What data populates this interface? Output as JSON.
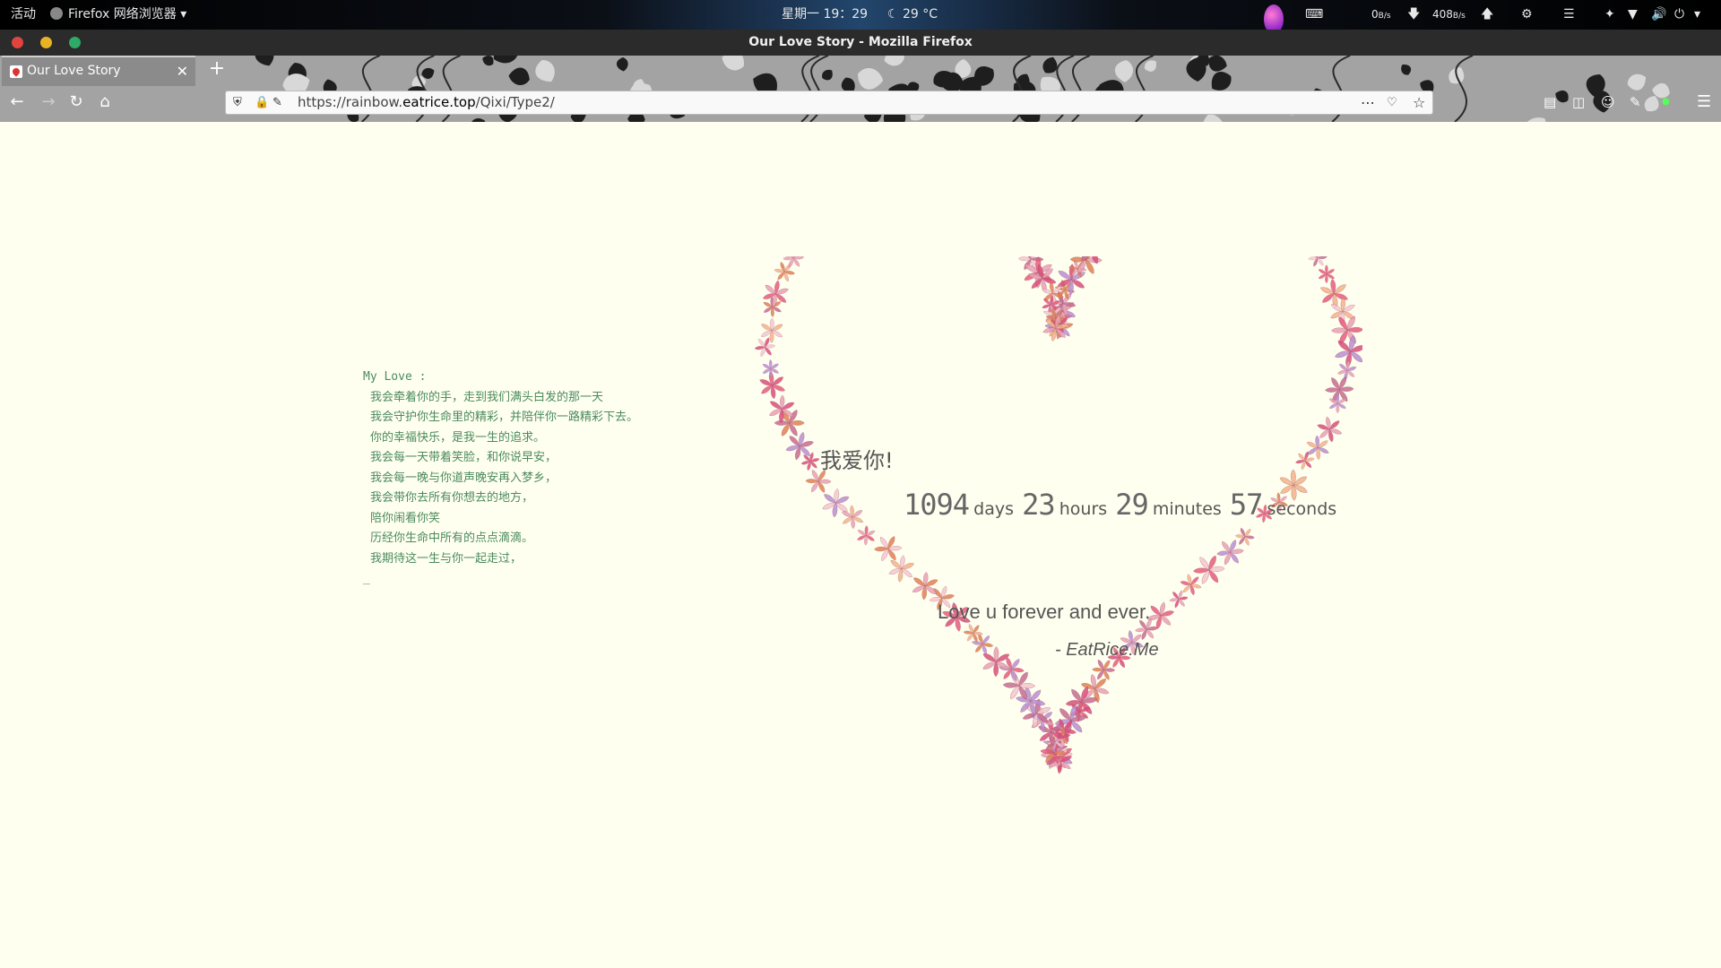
{
  "system_bar": {
    "activities": "活动",
    "app_menu": "Firefox 网络浏览器",
    "clock": "星期一 19：29",
    "weather": "29 °C",
    "net_down": "0",
    "net_down_unit": "B/s",
    "net_up": "408",
    "net_up_unit": "B/s"
  },
  "window": {
    "title": "Our Love Story - Mozilla Firefox"
  },
  "tab": {
    "title": "Our Love Story"
  },
  "urlbar": {
    "url_prefix": "https://rainbow.",
    "url_domain": "eatrice.top",
    "url_path": "/Qixi/Type2/"
  },
  "letter": {
    "greeting": "My Love :",
    "lines": [
      "我会牵着你的手，走到我们满头白发的那一天",
      "我会守护你生命里的精彩，并陪伴你一路精彩下去。",
      "你的幸福快乐，是我一生的追求。",
      "我会每一天带着笑脸，和你说早安，",
      "我会每一晚与你道声晚安再入梦乡，",
      "我会带你去所有你想去的地方，",
      "陪你闹看你笑",
      "历经你生命中所有的点点滴滴。",
      "我期待这一生与你一起走过，"
    ],
    "cursor": "_"
  },
  "heart": {
    "headline": "我爱你!",
    "counter": {
      "days": "1094",
      "days_label": "days",
      "hours": "23",
      "hours_label": "hours",
      "minutes": "29",
      "minutes_label": "minutes",
      "seconds": "57",
      "seconds_label": "seconds"
    },
    "message": "Love u forever and ever.",
    "signature": "- EatRice.Me"
  },
  "colors": {
    "page_bg": "#fffff0",
    "letter_text": "#4a8a5d",
    "petal_palette": [
      "#e8a0b4",
      "#d94f7a",
      "#f2b38a",
      "#c56c8f",
      "#e65c7b",
      "#b98ed1",
      "#f4c7cf",
      "#e08050"
    ]
  }
}
